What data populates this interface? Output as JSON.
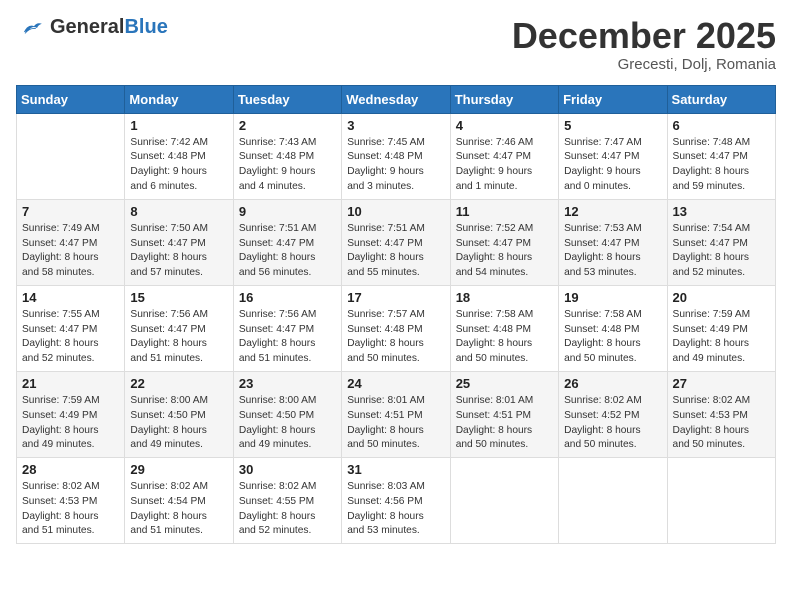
{
  "header": {
    "logo_general": "General",
    "logo_blue": "Blue",
    "month_title": "December 2025",
    "location": "Grecesti, Dolj, Romania"
  },
  "calendar": {
    "days_of_week": [
      "Sunday",
      "Monday",
      "Tuesday",
      "Wednesday",
      "Thursday",
      "Friday",
      "Saturday"
    ],
    "weeks": [
      [
        {
          "day": "",
          "info": ""
        },
        {
          "day": "1",
          "info": "Sunrise: 7:42 AM\nSunset: 4:48 PM\nDaylight: 9 hours\nand 6 minutes."
        },
        {
          "day": "2",
          "info": "Sunrise: 7:43 AM\nSunset: 4:48 PM\nDaylight: 9 hours\nand 4 minutes."
        },
        {
          "day": "3",
          "info": "Sunrise: 7:45 AM\nSunset: 4:48 PM\nDaylight: 9 hours\nand 3 minutes."
        },
        {
          "day": "4",
          "info": "Sunrise: 7:46 AM\nSunset: 4:47 PM\nDaylight: 9 hours\nand 1 minute."
        },
        {
          "day": "5",
          "info": "Sunrise: 7:47 AM\nSunset: 4:47 PM\nDaylight: 9 hours\nand 0 minutes."
        },
        {
          "day": "6",
          "info": "Sunrise: 7:48 AM\nSunset: 4:47 PM\nDaylight: 8 hours\nand 59 minutes."
        }
      ],
      [
        {
          "day": "7",
          "info": "Sunrise: 7:49 AM\nSunset: 4:47 PM\nDaylight: 8 hours\nand 58 minutes."
        },
        {
          "day": "8",
          "info": "Sunrise: 7:50 AM\nSunset: 4:47 PM\nDaylight: 8 hours\nand 57 minutes."
        },
        {
          "day": "9",
          "info": "Sunrise: 7:51 AM\nSunset: 4:47 PM\nDaylight: 8 hours\nand 56 minutes."
        },
        {
          "day": "10",
          "info": "Sunrise: 7:51 AM\nSunset: 4:47 PM\nDaylight: 8 hours\nand 55 minutes."
        },
        {
          "day": "11",
          "info": "Sunrise: 7:52 AM\nSunset: 4:47 PM\nDaylight: 8 hours\nand 54 minutes."
        },
        {
          "day": "12",
          "info": "Sunrise: 7:53 AM\nSunset: 4:47 PM\nDaylight: 8 hours\nand 53 minutes."
        },
        {
          "day": "13",
          "info": "Sunrise: 7:54 AM\nSunset: 4:47 PM\nDaylight: 8 hours\nand 52 minutes."
        }
      ],
      [
        {
          "day": "14",
          "info": "Sunrise: 7:55 AM\nSunset: 4:47 PM\nDaylight: 8 hours\nand 52 minutes."
        },
        {
          "day": "15",
          "info": "Sunrise: 7:56 AM\nSunset: 4:47 PM\nDaylight: 8 hours\nand 51 minutes."
        },
        {
          "day": "16",
          "info": "Sunrise: 7:56 AM\nSunset: 4:47 PM\nDaylight: 8 hours\nand 51 minutes."
        },
        {
          "day": "17",
          "info": "Sunrise: 7:57 AM\nSunset: 4:48 PM\nDaylight: 8 hours\nand 50 minutes."
        },
        {
          "day": "18",
          "info": "Sunrise: 7:58 AM\nSunset: 4:48 PM\nDaylight: 8 hours\nand 50 minutes."
        },
        {
          "day": "19",
          "info": "Sunrise: 7:58 AM\nSunset: 4:48 PM\nDaylight: 8 hours\nand 50 minutes."
        },
        {
          "day": "20",
          "info": "Sunrise: 7:59 AM\nSunset: 4:49 PM\nDaylight: 8 hours\nand 49 minutes."
        }
      ],
      [
        {
          "day": "21",
          "info": "Sunrise: 7:59 AM\nSunset: 4:49 PM\nDaylight: 8 hours\nand 49 minutes."
        },
        {
          "day": "22",
          "info": "Sunrise: 8:00 AM\nSunset: 4:50 PM\nDaylight: 8 hours\nand 49 minutes."
        },
        {
          "day": "23",
          "info": "Sunrise: 8:00 AM\nSunset: 4:50 PM\nDaylight: 8 hours\nand 49 minutes."
        },
        {
          "day": "24",
          "info": "Sunrise: 8:01 AM\nSunset: 4:51 PM\nDaylight: 8 hours\nand 50 minutes."
        },
        {
          "day": "25",
          "info": "Sunrise: 8:01 AM\nSunset: 4:51 PM\nDaylight: 8 hours\nand 50 minutes."
        },
        {
          "day": "26",
          "info": "Sunrise: 8:02 AM\nSunset: 4:52 PM\nDaylight: 8 hours\nand 50 minutes."
        },
        {
          "day": "27",
          "info": "Sunrise: 8:02 AM\nSunset: 4:53 PM\nDaylight: 8 hours\nand 50 minutes."
        }
      ],
      [
        {
          "day": "28",
          "info": "Sunrise: 8:02 AM\nSunset: 4:53 PM\nDaylight: 8 hours\nand 51 minutes."
        },
        {
          "day": "29",
          "info": "Sunrise: 8:02 AM\nSunset: 4:54 PM\nDaylight: 8 hours\nand 51 minutes."
        },
        {
          "day": "30",
          "info": "Sunrise: 8:02 AM\nSunset: 4:55 PM\nDaylight: 8 hours\nand 52 minutes."
        },
        {
          "day": "31",
          "info": "Sunrise: 8:03 AM\nSunset: 4:56 PM\nDaylight: 8 hours\nand 53 minutes."
        },
        {
          "day": "",
          "info": ""
        },
        {
          "day": "",
          "info": ""
        },
        {
          "day": "",
          "info": ""
        }
      ]
    ]
  }
}
